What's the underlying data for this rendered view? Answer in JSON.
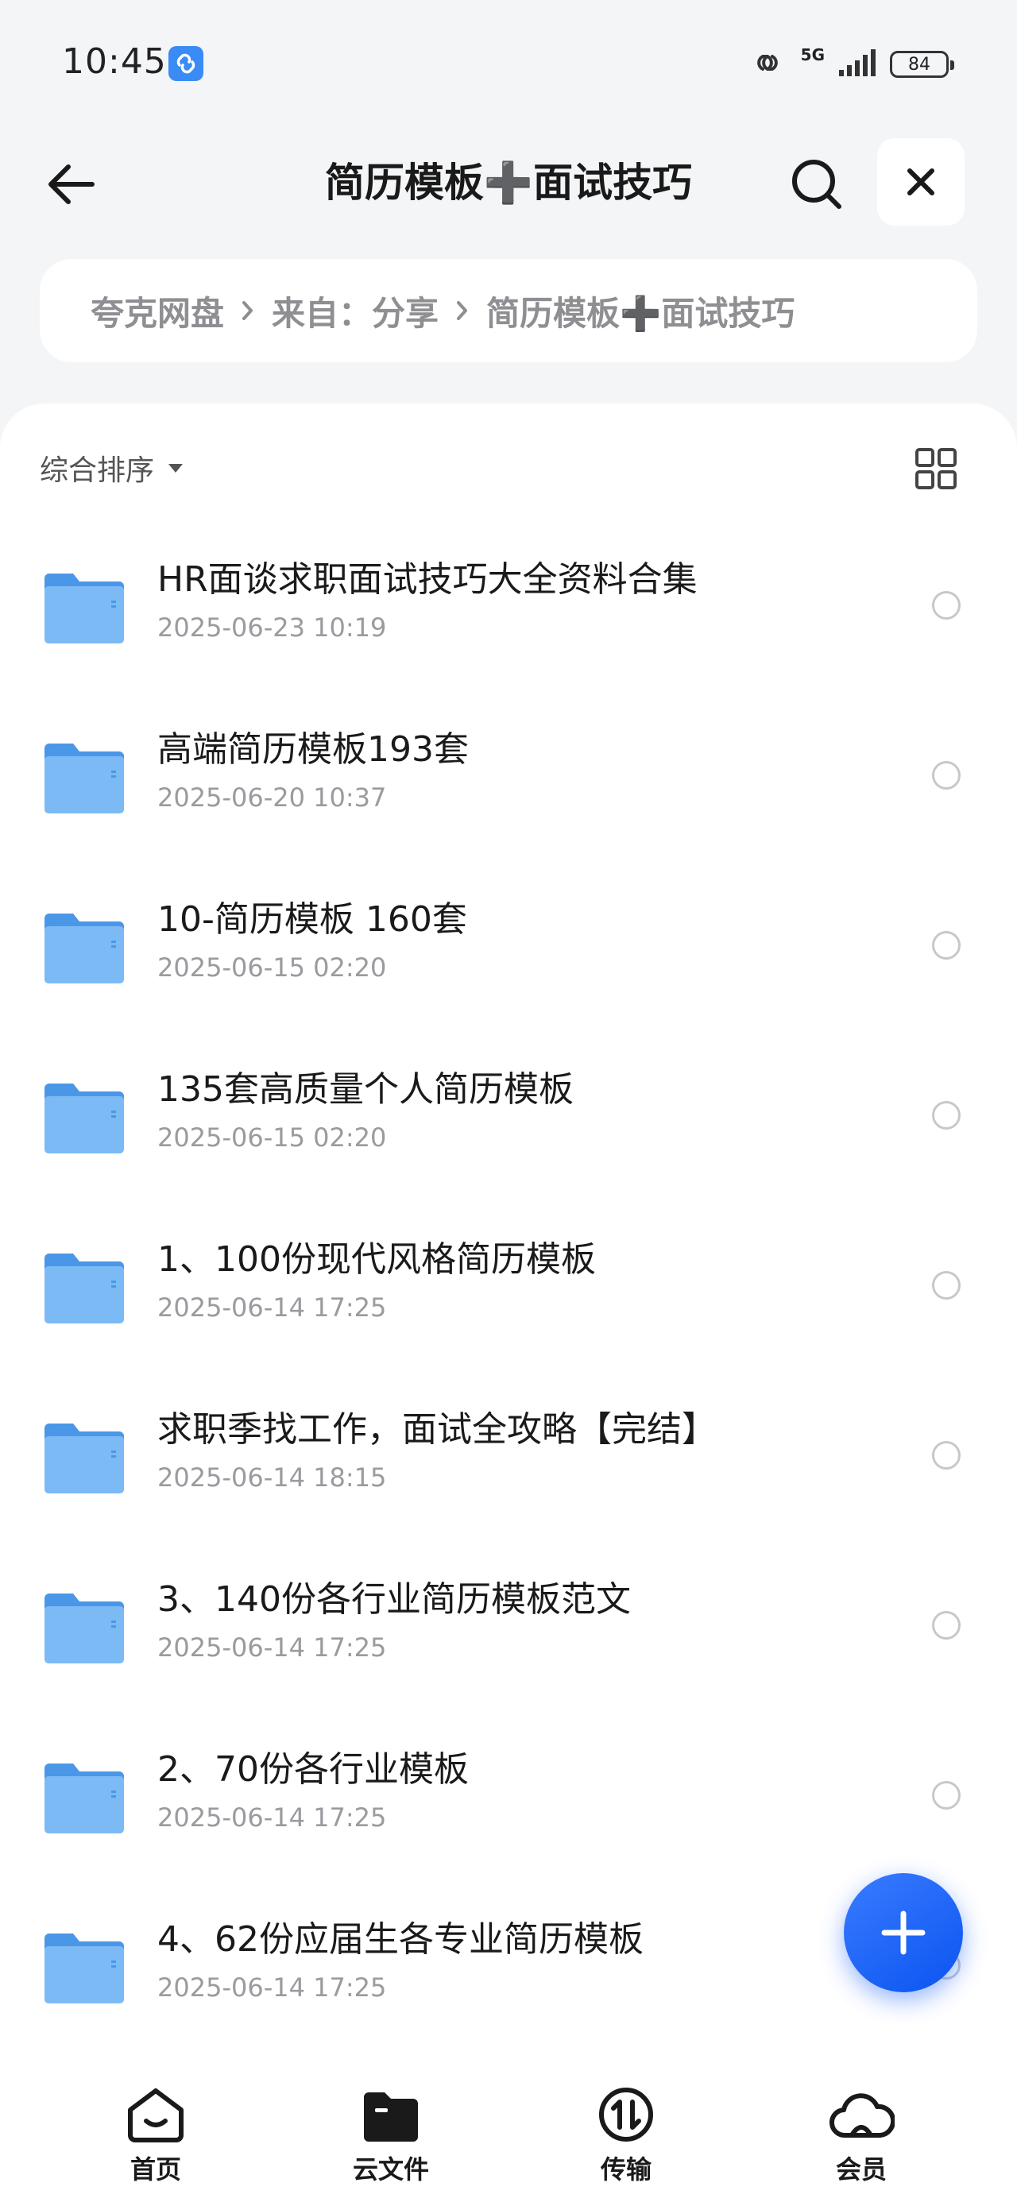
{
  "status_bar": {
    "time": "10:45",
    "network": "5G",
    "battery": "84"
  },
  "header": {
    "title": "简历模板➕面试技巧"
  },
  "breadcrumb": {
    "items": [
      "夸克网盘",
      "来自：分享",
      "简历模板➕面试技巧"
    ]
  },
  "toolbar": {
    "sort_label": "综合排序"
  },
  "files": [
    {
      "name": "HR面谈求职面试技巧大全资料合集",
      "date": "2025-06-23 10:19"
    },
    {
      "name": "高端简历模板193套",
      "date": "2025-06-20 10:37"
    },
    {
      "name": "10-简历模板 160套",
      "date": "2025-06-15 02:20"
    },
    {
      "name": "135套高质量个人简历模板",
      "date": "2025-06-15 02:20"
    },
    {
      "name": "1、100份现代风格简历模板",
      "date": "2025-06-14 17:25"
    },
    {
      "name": "求职季找工作，面试全攻略【完结】",
      "date": "2025-06-14 18:15"
    },
    {
      "name": "3、140份各行业简历模板范文",
      "date": "2025-06-14 17:25"
    },
    {
      "name": "2、70份各行业模板",
      "date": "2025-06-14 17:25"
    },
    {
      "name": "4、62份应届生各专业简历模板",
      "date": "2025-06-14 17:25"
    }
  ],
  "tabbar": {
    "items": [
      {
        "label": "首页",
        "icon": "home-icon"
      },
      {
        "label": "云文件",
        "icon": "folder-icon"
      },
      {
        "label": "传输",
        "icon": "transfer-icon"
      },
      {
        "label": "会员",
        "icon": "cloud-icon"
      }
    ]
  },
  "colors": {
    "accent": "#1a5cff",
    "folder": "#5fa8ef",
    "background": "#f4f5f7"
  }
}
